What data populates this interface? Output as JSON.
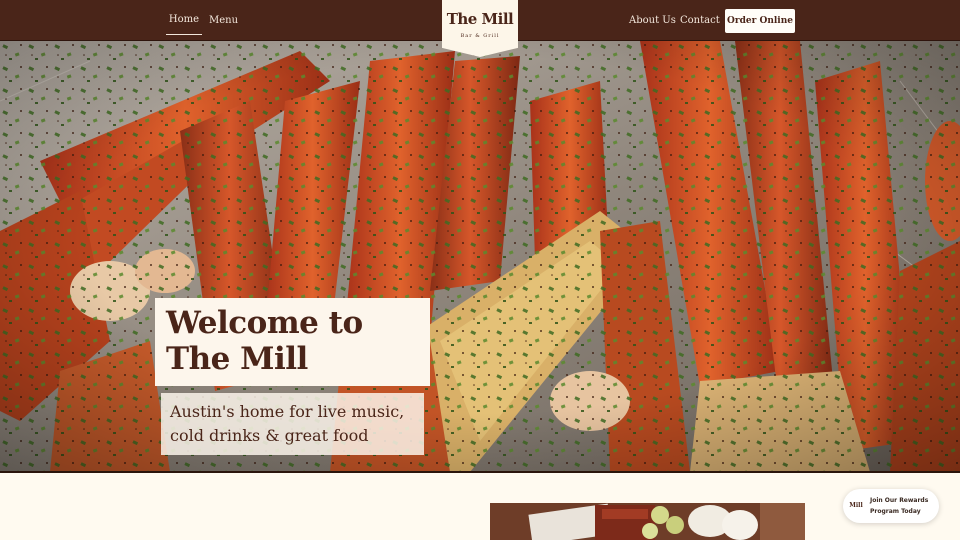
{
  "nav": {
    "home": "Home",
    "menu": "Menu",
    "about": "About Us",
    "contact": "Contact",
    "order_cta": "Order Online"
  },
  "logo": {
    "wordmark": "The Mill",
    "subtitle": "Bar & Grill"
  },
  "hero": {
    "title": "Welcome to The Mill",
    "tagline": "Austin's home for live music, cold drinks & great food"
  },
  "rewards": {
    "icon_text": "Mill",
    "label": "Join Our Rewards Program Today"
  },
  "colors": {
    "brand_brown": "#4a2519",
    "cream": "#fdf6ec",
    "page_bg": "#fffaf0"
  }
}
